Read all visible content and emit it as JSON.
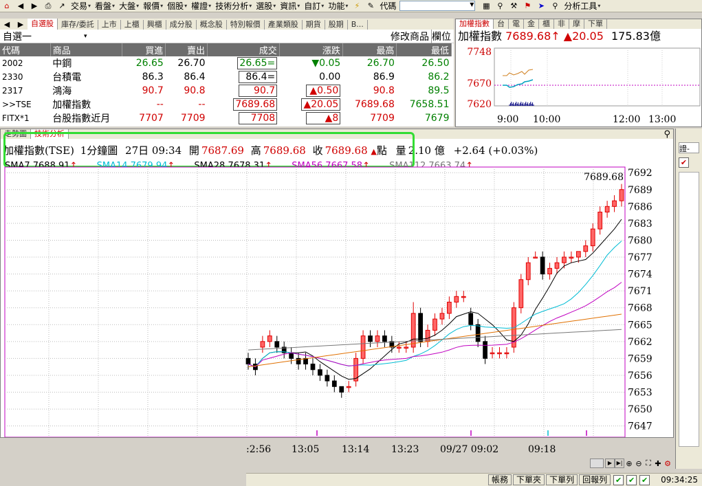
{
  "menubar": {
    "items": [
      "交易",
      "看盤",
      "大盤",
      "報價",
      "個股",
      "權證",
      "技術分析",
      "選股",
      "資訊",
      "自訂",
      "功能"
    ],
    "code_label": "代碼",
    "analysis_tools": "分析工具"
  },
  "watchlist": {
    "group": "自選一",
    "tabs": [
      "自選股",
      "庫存/委託",
      "上市",
      "上櫃",
      "興櫃",
      "成分股",
      "概念股",
      "特別報價",
      "產業類股",
      "期貨",
      "股期",
      "B..."
    ],
    "modify_label": "修改商品",
    "column_label": "欄位",
    "columns": [
      "代碼",
      "商品",
      "買進",
      "賣出",
      "成交",
      "漲跌",
      "最高",
      "最低"
    ],
    "rows": [
      {
        "code": "2002",
        "name": "中鋼",
        "bid": "26.65",
        "ask": "26.70",
        "last": "26.65=",
        "change": "0.05",
        "change_dir": "down",
        "high": "26.70",
        "low": "26.50",
        "color": "g"
      },
      {
        "code": "2330",
        "name": "台積電",
        "bid": "86.3",
        "ask": "86.4",
        "last": "86.4=",
        "change": "0.00",
        "change_dir": "flat",
        "high": "86.9",
        "low": "86.2",
        "color": "k"
      },
      {
        "code": "2317",
        "name": "鴻海",
        "bid": "90.7",
        "ask": "90.8",
        "last": "90.7",
        "change": "0.50",
        "change_dir": "up",
        "high": "90.8",
        "low": "89.5",
        "color": "r"
      },
      {
        "code": ">>TSE",
        "name": "加權指數",
        "bid": "--",
        "ask": "--",
        "last": "7689.68",
        "change": "20.05",
        "change_dir": "up",
        "high": "7689.68",
        "low": "7658.51",
        "color": "r"
      },
      {
        "code": "FITX*1",
        "name": "台股指數近月",
        "bid": "7707",
        "ask": "7709",
        "last": "7708",
        "change": "8",
        "change_dir": "up",
        "high": "7709",
        "low": "7679",
        "color": "r"
      }
    ]
  },
  "mini": {
    "tabs": [
      "加權指數",
      "台",
      "電",
      "金",
      "櫃",
      "非",
      "摩",
      "下單"
    ],
    "title": "加權指數",
    "price": "7689.68",
    "change": "20.05",
    "volume": "175.83億",
    "y_labels": [
      "7748",
      "7670",
      "7620"
    ],
    "x_labels": [
      "9:00",
      "10:00",
      "12:00",
      "13:00"
    ]
  },
  "chart": {
    "tabs": [
      "走勢圖",
      "技術分析"
    ],
    "info": {
      "symbol": "加權指數(TSE)",
      "period": "1分鐘圖",
      "datetime": "27日 09:34",
      "open_label": "開",
      "open": "7687.69",
      "high_label": "高",
      "high": "7689.68",
      "close_label": "收",
      "close": "7689.68",
      "unit": "點",
      "vol_label": "量",
      "vol": "2.10 億",
      "chg": "+2.64 (+0.03%)"
    },
    "sma": [
      "SMA7 7688.91",
      "SMA14 7679.94",
      "SMA28 7678.31",
      "SMA56 7667.58",
      "SMA112 7663.74"
    ],
    "last_label": "7689.68",
    "x_labels": [
      ":2:56",
      "13:05",
      "13:14",
      "13:23",
      "09/27 09:02",
      "09:18"
    ]
  },
  "chart_data": {
    "type": "candlestick",
    "ylim": [
      7645,
      7693
    ],
    "y_ticks": [
      7692,
      7689,
      7686,
      7683,
      7680,
      7677,
      7674,
      7671,
      7668,
      7665,
      7662,
      7659,
      7656,
      7653,
      7650,
      7647
    ],
    "candles": [
      [
        7659,
        7660,
        7657,
        7658
      ],
      [
        7658,
        7659,
        7656,
        7657
      ],
      [
        7661,
        7663,
        7660,
        7662
      ],
      [
        7662,
        7664,
        7661,
        7663
      ],
      [
        7662,
        7663,
        7660,
        7661
      ],
      [
        7661,
        7662,
        7659,
        7660
      ],
      [
        7660,
        7661,
        7658,
        7659
      ],
      [
        7659,
        7660,
        7657,
        7658
      ],
      [
        7659,
        7660,
        7657,
        7658
      ],
      [
        7658,
        7659,
        7656,
        7657
      ],
      [
        7657,
        7658,
        7655,
        7656
      ],
      [
        7656,
        7657,
        7654,
        7655
      ],
      [
        7655,
        7656,
        7653,
        7654
      ],
      [
        7654,
        7654,
        7652,
        7653
      ],
      [
        7654,
        7655,
        7653,
        7654
      ],
      [
        7655,
        7660,
        7654,
        7659
      ],
      [
        7659,
        7664,
        7658,
        7663
      ],
      [
        7663,
        7664,
        7661,
        7662
      ],
      [
        7662,
        7664,
        7661,
        7663
      ],
      [
        7663,
        7664,
        7661,
        7662
      ],
      [
        7662,
        7663,
        7660,
        7661
      ],
      [
        7661,
        7662,
        7660,
        7661
      ],
      [
        7661,
        7662,
        7660,
        7661
      ],
      [
        7661,
        7669,
        7660,
        7667
      ],
      [
        7667,
        7668,
        7661,
        7662
      ],
      [
        7662,
        7665,
        7661,
        7664
      ],
      [
        7664,
        7667,
        7663,
        7666
      ],
      [
        7666,
        7668,
        7665,
        7667
      ],
      [
        7667,
        7670,
        7666,
        7669
      ],
      [
        7669,
        7671,
        7668,
        7670
      ],
      [
        7670,
        7671,
        7669,
        7670
      ],
      [
        7667,
        7668,
        7664,
        7665
      ],
      [
        7665,
        7666,
        7661,
        7662
      ],
      [
        7662,
        7663,
        7658,
        7659
      ],
      [
        7660,
        7661,
        7659,
        7660
      ],
      [
        7660,
        7661,
        7659,
        7660
      ],
      [
        7660,
        7661,
        7659,
        7660
      ],
      [
        7661,
        7669,
        7660,
        7668
      ],
      [
        7668,
        7674,
        7667,
        7673
      ],
      [
        7673,
        7677,
        7672,
        7676
      ],
      [
        7677,
        7678,
        7677,
        7677
      ],
      [
        7677,
        7678,
        7673,
        7674
      ],
      [
        7674,
        7676,
        7673,
        7675
      ],
      [
        7675,
        7677,
        7674,
        7676
      ],
      [
        7676,
        7678,
        7675,
        7677
      ],
      [
        7677,
        7678,
        7676,
        7677
      ],
      [
        7677,
        7678,
        7676,
        7678
      ],
      [
        7678,
        7680,
        7677,
        7679
      ],
      [
        7679,
        7683,
        7678,
        7682
      ],
      [
        7682,
        7686,
        7681,
        7685
      ],
      [
        7685,
        7687,
        7684,
        7686
      ],
      [
        7686,
        7688,
        7685,
        7687
      ],
      [
        7687,
        7690,
        7686,
        7689
      ]
    ]
  }
}
